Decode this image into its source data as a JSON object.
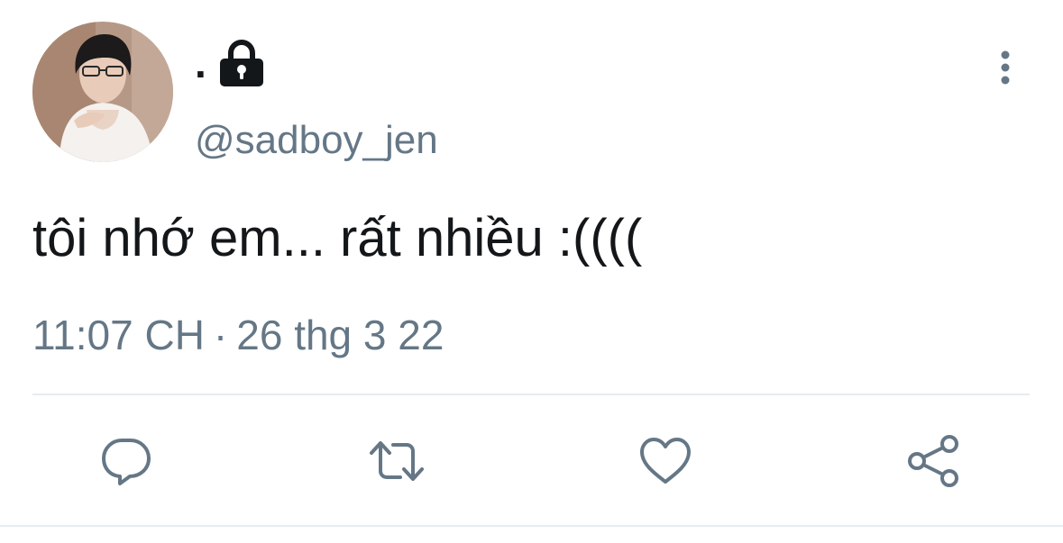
{
  "tweet": {
    "display_name": ".",
    "handle": "@sadboy_jen",
    "text": "tôi nhớ em... rất nhiều :((((",
    "time": "11:07 CH",
    "separator": "·",
    "date": "26 thg 3 22",
    "protected_icon": "lock-icon",
    "avatar": "profile-photo"
  },
  "actions": [
    {
      "icon": "reply-icon"
    },
    {
      "icon": "retweet-icon"
    },
    {
      "icon": "like-icon"
    },
    {
      "icon": "share-icon"
    }
  ],
  "colors": {
    "text_primary": "#14171a",
    "text_secondary": "#657786",
    "icon": "#657786",
    "divider": "#e6ecf0"
  }
}
